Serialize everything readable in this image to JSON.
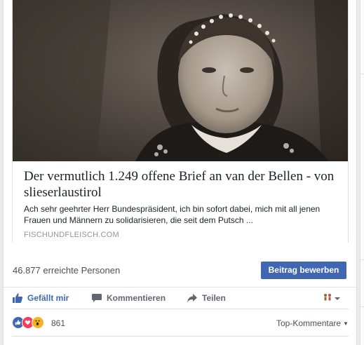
{
  "link_preview": {
    "image_alt": "Sepia portrait photo of a woman wearing a beaded headband",
    "headline": "Der vermutlich 1.249 offene Brief an van der Bellen - von slieserlaustirol",
    "description": "Ach sehr geehrter Herr Bundespräsident, ich bin sofort dabei, mich mit all jenen Frauen und Männern zu solidarisieren, die seit dem Putsch ...",
    "domain": "FISCHUNDFLEISCH.COM"
  },
  "reach": {
    "text": "46.877 erreichte Personen",
    "boost_label": "Beitrag bewerben"
  },
  "actions": {
    "like_label": "Gefällt mir",
    "comment_label": "Kommentieren",
    "share_label": "Teilen"
  },
  "reactions": {
    "count": "861",
    "sort_label": "Top-Kommentare"
  },
  "colors": {
    "brand_blue": "#4267b2",
    "text_gray": "#606770",
    "background": "#e9ebee"
  }
}
